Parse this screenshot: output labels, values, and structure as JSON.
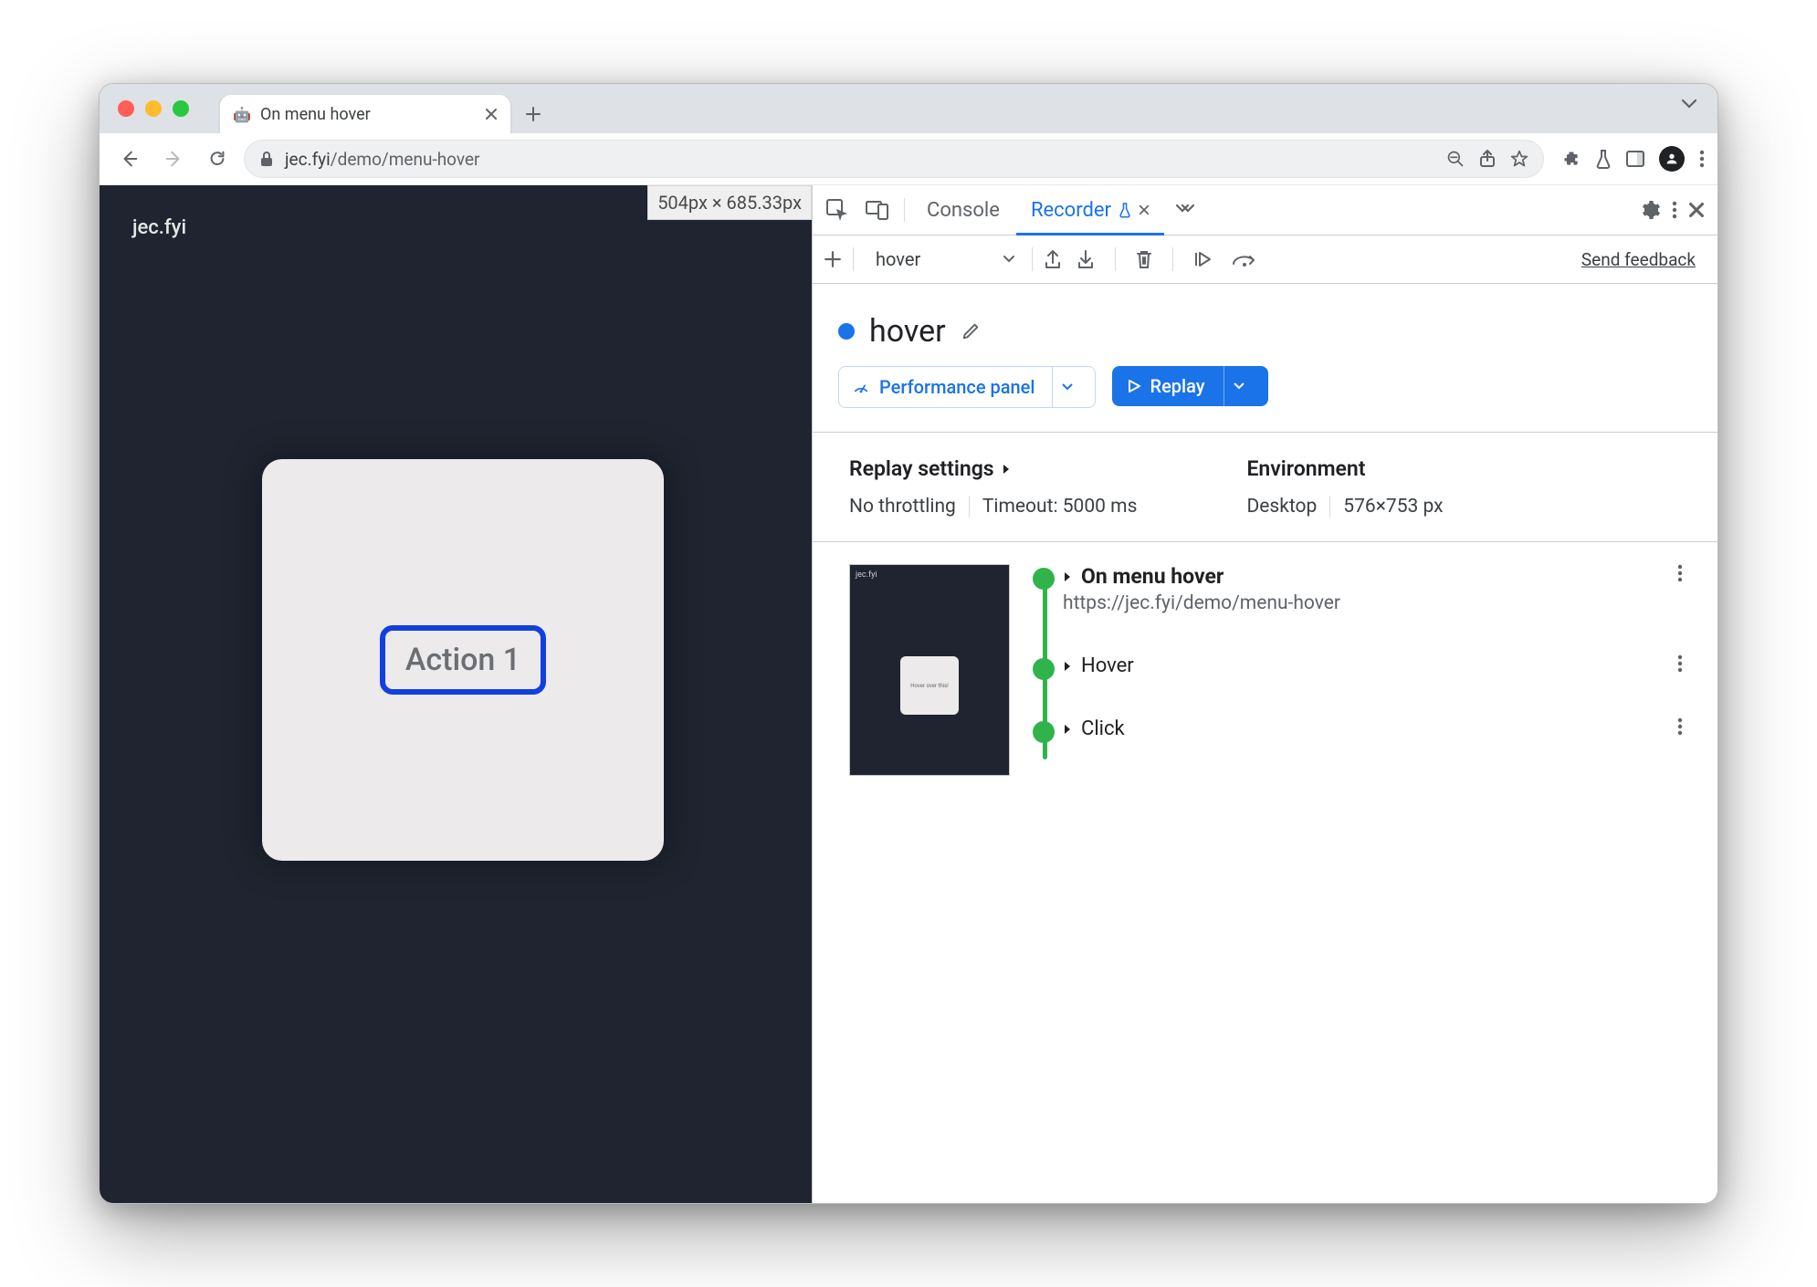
{
  "browser": {
    "tab_title": "On menu hover",
    "url_host": "jec.fyi",
    "url_path": "/demo/menu-hover"
  },
  "page": {
    "site_name": "jec.fyi",
    "viewport_label": "504px × 685.33px",
    "action_button": "Action 1"
  },
  "devtools": {
    "tabs": {
      "console": "Console",
      "recorder": "Recorder"
    },
    "recording_select": "hover",
    "feedback": "Send feedback",
    "title": "hover",
    "perf_button": "Performance panel",
    "replay_button": "Replay",
    "settings_header": "Replay settings",
    "env_header": "Environment",
    "throttling": "No throttling",
    "timeout": "Timeout: 5000 ms",
    "device": "Desktop",
    "resolution": "576×753 px",
    "steps": {
      "s1_title": "On menu hover",
      "s1_sub": "https://jec.fyi/demo/menu-hover",
      "s2": "Hover",
      "s3": "Click"
    },
    "thumb_text": "Hover over this!"
  }
}
